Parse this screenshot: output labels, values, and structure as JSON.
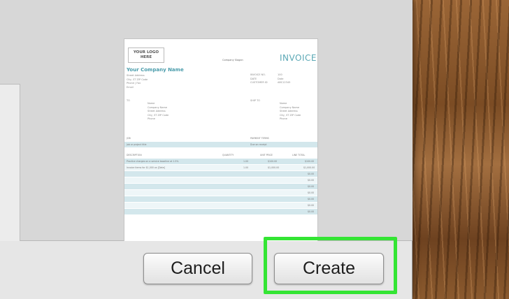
{
  "invoice_preview": {
    "logo_text_line1": "YOUR LOGO",
    "logo_text_line2": "HERE",
    "slogan": "Company Slogan",
    "title": "INVOICE",
    "company_name": "Your Company Name",
    "address_lines": [
      "Street Address",
      "City, ST ZIP Code",
      "Phone | Fax",
      "Email"
    ],
    "meta": [
      {
        "label": "INVOICE NO.",
        "value": "100"
      },
      {
        "label": "DATE",
        "value": "Date"
      },
      {
        "label": "CUSTOMER ID",
        "value": "ABC12345"
      }
    ],
    "to_label": "TO",
    "to_lines": [
      "Name",
      "Company Name",
      "Street Address",
      "City, ST ZIP Code",
      "Phone"
    ],
    "ship_to_label": "SHIP TO",
    "ship_to_lines": [
      "Name",
      "Company Name",
      "Street Address",
      "City, ST ZIP Code",
      "Phone"
    ],
    "job_header": "JOB",
    "payment_terms_header": "PAYMENT TERMS",
    "job_value": "Job or project title",
    "payment_terms_value": "Due on receipt",
    "columns": [
      "DESCRIPTION",
      "QUANTITY",
      "UNIT PRICE",
      "LINE TOTAL"
    ],
    "items": [
      {
        "description": "Practice charges on a service baseline at 1.5%",
        "qty": "1.00",
        "unit": "$100.00",
        "total": "$100.00"
      },
      {
        "description": "Invoice items for $1,000 on [Date]",
        "qty": "1.00",
        "unit": "$1,000.00",
        "total": "$1,000.00"
      }
    ],
    "empty_totals": [
      "$0.00",
      "$0.00",
      "$0.00",
      "$0.00",
      "$0.00",
      "$0.00",
      "$0.00"
    ]
  },
  "buttons": {
    "cancel_label": "Cancel",
    "create_label": "Create"
  },
  "colors": {
    "accent_teal": "#5aa8b5",
    "highlight_green": "#34e534",
    "dialog_bg": "#e6e6e6"
  }
}
